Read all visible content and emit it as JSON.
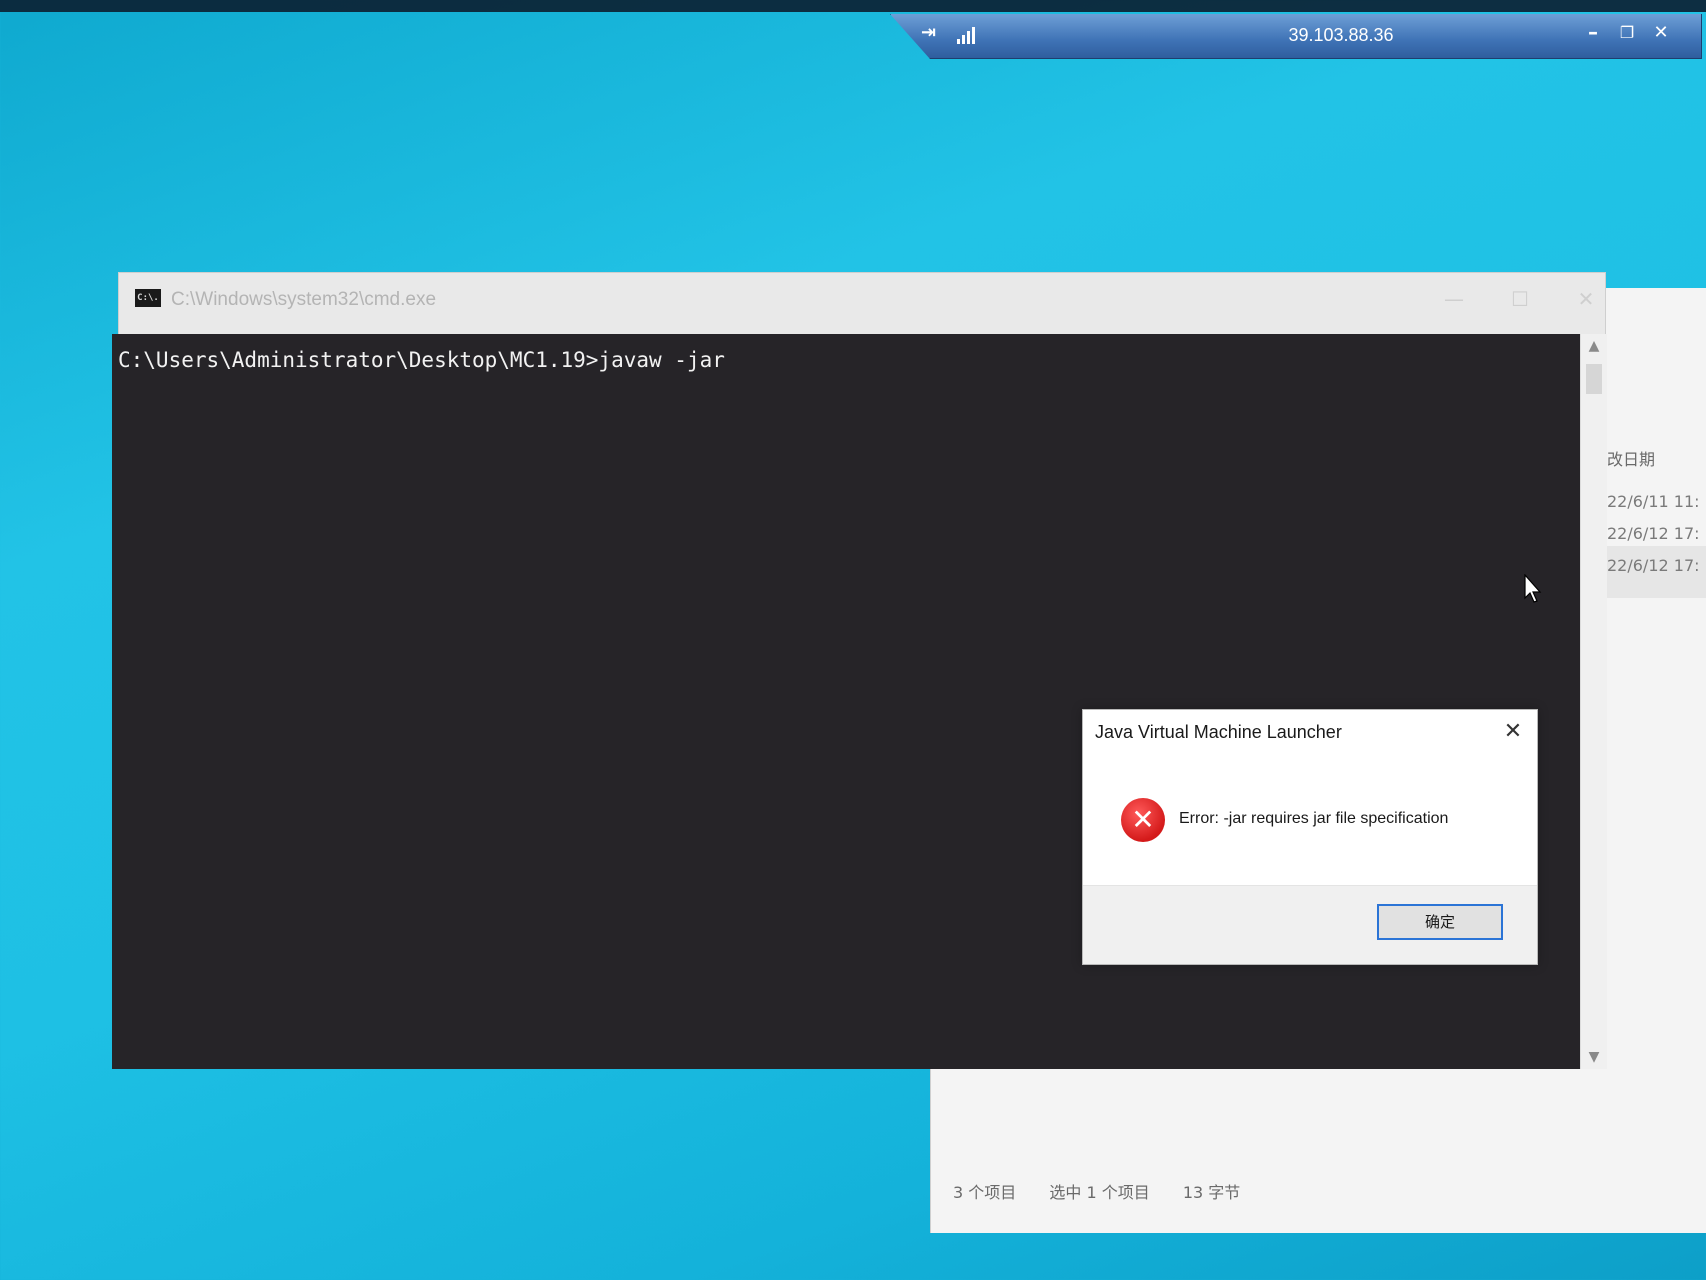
{
  "rdp_bar": {
    "title": "39.103.88.36",
    "pin_icon": "pin-icon",
    "signal_icon": "signal-strength-icon",
    "minimize_label": "–",
    "restore_label": "❐",
    "close_label": "✕"
  },
  "explorer": {
    "column_header": "改日期",
    "rows": [
      "22/6/11 11:",
      "22/6/12 17:",
      "22/6/12 17:"
    ],
    "status": {
      "item_count": "3 个项目",
      "selected": "选中 1 个项目",
      "size": "13 字节"
    }
  },
  "cmd": {
    "title": "C:\\Windows\\system32\\cmd.exe",
    "icon_text": "C:\\.",
    "minimize_label": "—",
    "maximize_label": "☐",
    "close_label": "✕",
    "command_line": "C:\\Users\\Administrator\\Desktop\\MC1.19>javaw -jar"
  },
  "dialog": {
    "title": "Java Virtual Machine Launcher",
    "close_label": "✕",
    "message": "Error: -jar requires jar file specification",
    "ok_label": "确定",
    "error_icon": "error-icon"
  },
  "colors": {
    "desktop": "#1ec0e4",
    "cmd_background": "#262428",
    "dialog_button_border": "#2b74d6",
    "error_red": "#d41a1a"
  }
}
